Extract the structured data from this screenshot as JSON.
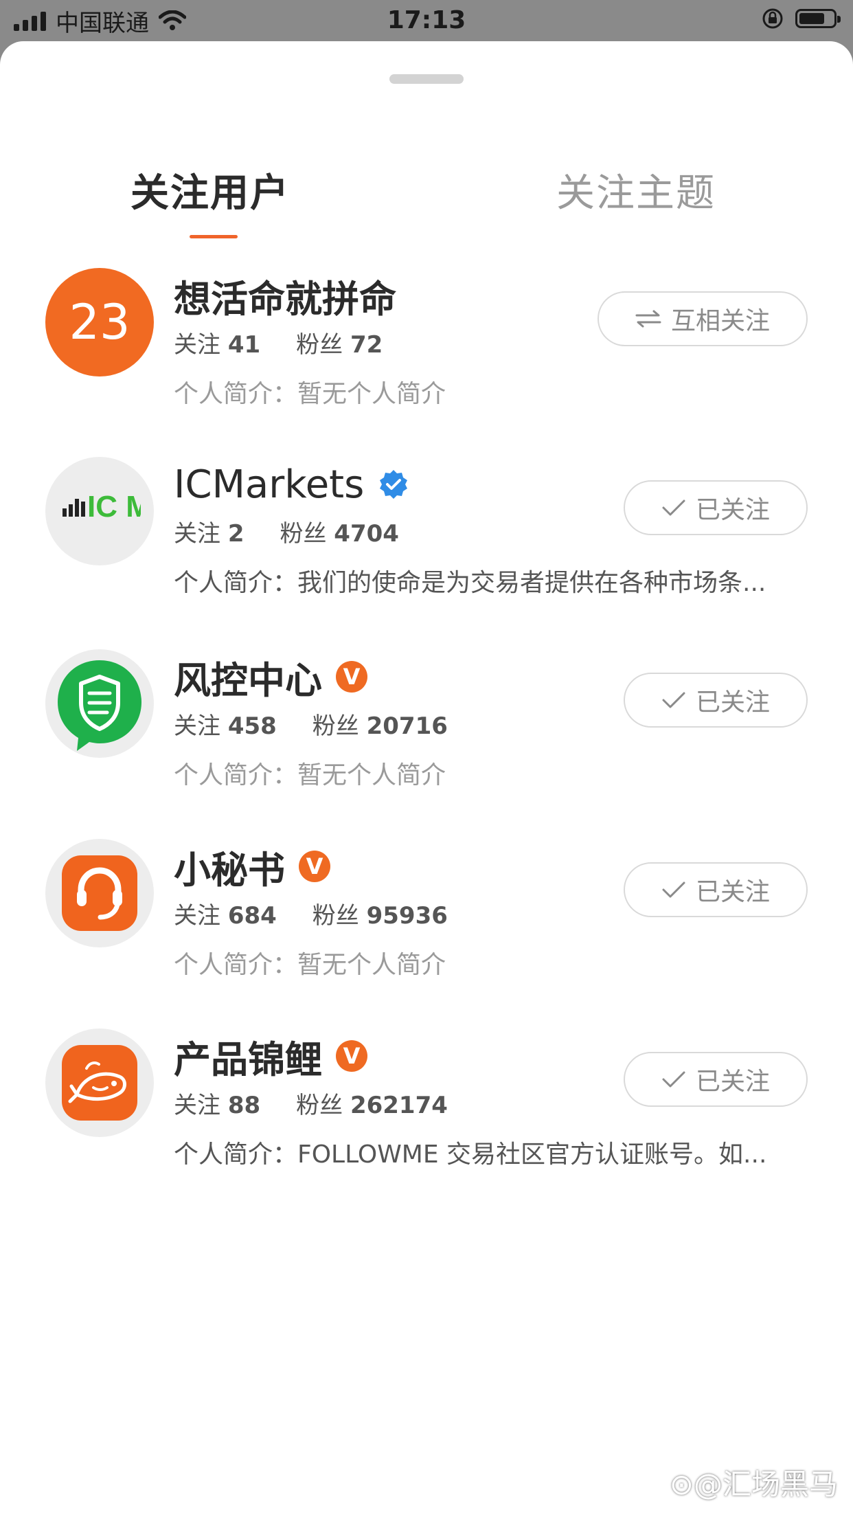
{
  "status_bar": {
    "carrier": "中国联通",
    "time": "17:13"
  },
  "tabs": [
    {
      "label": "关注用户",
      "active": true
    },
    {
      "label": "关注主题",
      "active": false
    }
  ],
  "accent_color": "#f0642a",
  "users": [
    {
      "avatar_text": "23",
      "name": "想活命就拼命",
      "verified": "",
      "following_label": "关注",
      "following": "41",
      "fans_label": "粉丝",
      "fans": "72",
      "bio": "个人简介：暂无个人简介",
      "button_icon": "mutual-arrows-icon",
      "button": "互相关注"
    },
    {
      "avatar_text": "IC Markets",
      "name": "ICMarkets",
      "verified": "blue-check",
      "following_label": "关注",
      "following": "2",
      "fans_label": "粉丝",
      "fans": "4704",
      "bio": "个人简介：我们的使命是为交易者提供在各种市场条...",
      "button_icon": "check-icon",
      "button": "已关注"
    },
    {
      "avatar_text": "",
      "name": "风控中心",
      "verified": "V",
      "following_label": "关注",
      "following": "458",
      "fans_label": "粉丝",
      "fans": "20716",
      "bio": "个人简介：暂无个人简介",
      "button_icon": "check-icon",
      "button": "已关注"
    },
    {
      "avatar_text": "",
      "name": "小秘书",
      "verified": "V",
      "following_label": "关注",
      "following": "684",
      "fans_label": "粉丝",
      "fans": "95936",
      "bio": "个人简介：暂无个人简介",
      "button_icon": "check-icon",
      "button": "已关注"
    },
    {
      "avatar_text": "",
      "name": "产品锦鲤",
      "verified": "V",
      "following_label": "关注",
      "following": "88",
      "fans_label": "粉丝",
      "fans": "262174",
      "bio": "个人简介：FOLLOWME 交易社区官方认证账号。如...",
      "button_icon": "check-icon",
      "button": "已关注"
    }
  ],
  "watermark": "@汇场黑马"
}
